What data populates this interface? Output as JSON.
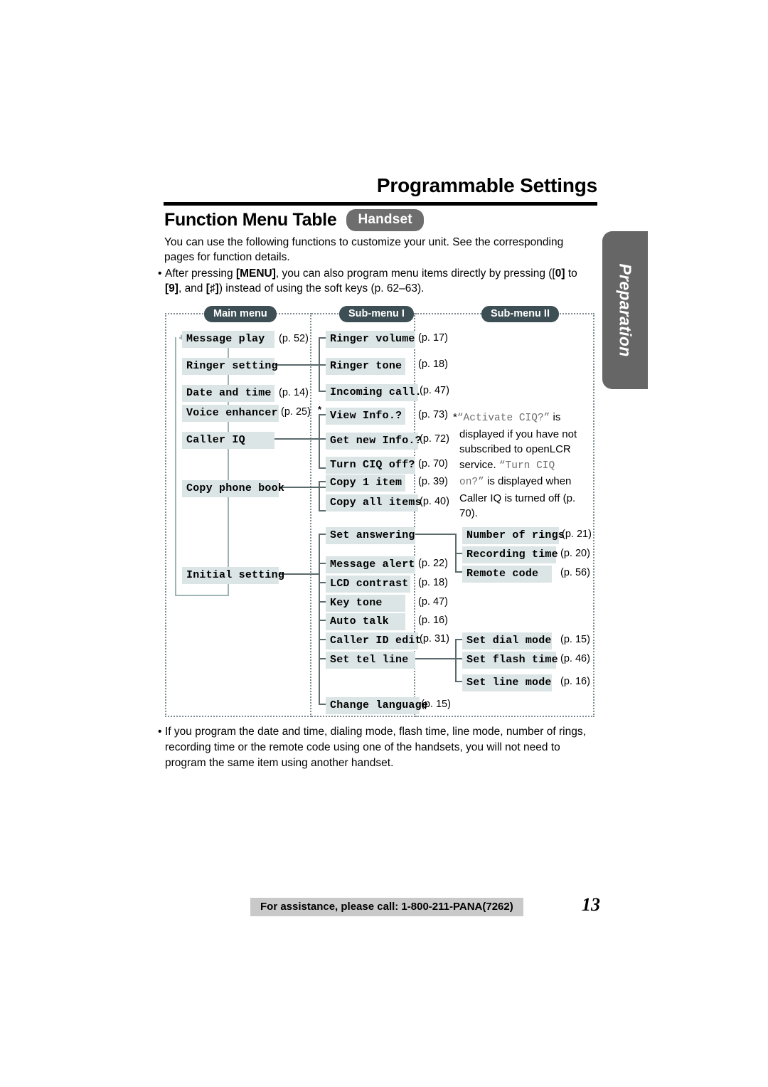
{
  "header": {
    "chapter_title": "Programmable Settings",
    "section_title": "Function Menu Table",
    "handset_badge": "Handset"
  },
  "side_tab": {
    "label": "Preparation"
  },
  "intro": {
    "paragraph": "You can use the following functions to customize your unit. See the corresponding pages for function details.",
    "bullet_prefix": "After pressing ",
    "bullet_key_menu": "[MENU]",
    "bullet_mid": ", you can also program menu items directly by pressing ([",
    "bullet_key_0": "0]",
    "bullet_to": " to ",
    "bullet_key_9": "[9]",
    "bullet_and": ", and ",
    "bullet_key_hash": "[♯]",
    "bullet_tail": ") instead of using the soft keys (p. 62–63)."
  },
  "diagram": {
    "columns": [
      {
        "id": "main",
        "label": "Main menu"
      },
      {
        "id": "sub1",
        "label": "Sub-menu I"
      },
      {
        "id": "sub2",
        "label": "Sub-menu II"
      }
    ],
    "main_menu": [
      {
        "label": "Message play",
        "page": "(p. 52)"
      },
      {
        "label": "Ringer setting",
        "page": ""
      },
      {
        "label": "Date and time",
        "page": "(p. 14)"
      },
      {
        "label": "Voice enhancer",
        "page": "(p. 25)"
      },
      {
        "label": "Caller IQ",
        "page": ""
      },
      {
        "label": "Copy phone book",
        "page": ""
      },
      {
        "label": "Initial setting",
        "page": ""
      }
    ],
    "sub_menu_1": [
      {
        "label": "Ringer volume",
        "page": "(p. 17)"
      },
      {
        "label": "Ringer tone",
        "page": "(p. 18)"
      },
      {
        "label": "Incoming call.",
        "page": "(p. 47)"
      },
      {
        "label": "View Info.?",
        "page": "(p. 73)"
      },
      {
        "label": "Get new Info.?",
        "page": "(p. 72)"
      },
      {
        "label": "Turn CIQ off?",
        "page": "(p. 70)"
      },
      {
        "label": "Copy 1 item",
        "page": "(p. 39)"
      },
      {
        "label": "Copy all items",
        "page": "(p. 40)"
      },
      {
        "label": "Set answering",
        "page": ""
      },
      {
        "label": "Message alert",
        "page": "(p. 22)"
      },
      {
        "label": "LCD contrast",
        "page": "(p. 18)"
      },
      {
        "label": "Key tone",
        "page": "(p. 47)"
      },
      {
        "label": "Auto talk",
        "page": "(p. 16)"
      },
      {
        "label": "Caller ID edit",
        "page": "(p. 31)"
      },
      {
        "label": "Set tel line",
        "page": ""
      },
      {
        "label": "Change language",
        "page": "(p. 15)"
      }
    ],
    "sub_menu_2": [
      {
        "label": "Number of rings",
        "page": "(p. 21)"
      },
      {
        "label": "Recording time",
        "page": "(p. 20)"
      },
      {
        "label": "Remote code",
        "page": "(p. 56)"
      },
      {
        "label": "Set dial mode",
        "page": "(p. 15)"
      },
      {
        "label": "Set flash time",
        "page": "(p. 46)"
      },
      {
        "label": "Set line mode",
        "page": "(p. 16)"
      }
    ],
    "star_marker": "*",
    "footnote": {
      "star": "*",
      "quote1": "“Activate CIQ?”",
      "text1": " is displayed if you have not subscribed to openLCR service. ",
      "quote2": "“Turn CIQ on?”",
      "text2": " is displayed when Caller IQ is turned off (p. 70)."
    }
  },
  "bottom_note": {
    "text": "If you program the date and time, dialing mode, flash time, line mode, number of rings, recording time or the remote code using one of the handsets, you will not need to program the same item using another handset."
  },
  "footer": {
    "assistance": "For assistance, please call: 1-800-211-PANA(7262)",
    "page_number": "13"
  },
  "colors": {
    "pill": "#3d4f55",
    "badge": "#6e6e6e",
    "box_fill": "#dce5e6",
    "connector": "#5b6a6d",
    "loop": "#9db4b6",
    "footer_bar": "#c9c9c9",
    "side_tab": "#666666"
  }
}
